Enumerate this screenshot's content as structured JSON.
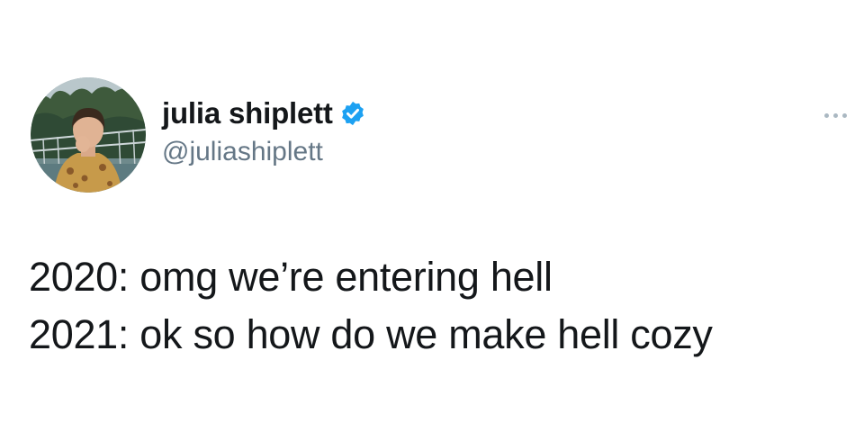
{
  "tweet": {
    "author": {
      "display_name": "julia shiplett",
      "handle": "@juliashiplett",
      "verified": true,
      "avatar_icon": "profile-photo-avatar",
      "verified_icon": "verified-badge-icon",
      "verified_color": "#1da1f2"
    },
    "more_icon": "more-options-icon",
    "lines": [
      "2020: omg we’re entering hell",
      "2021: ok so how do we make hell cozy"
    ]
  }
}
